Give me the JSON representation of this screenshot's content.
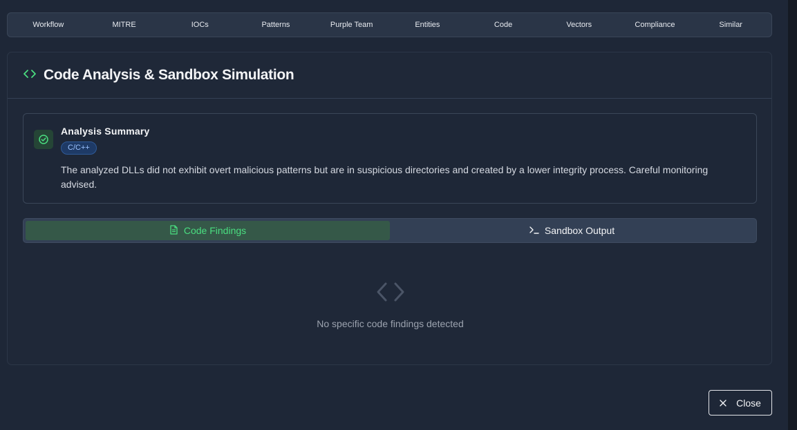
{
  "tabs": [
    "Workflow",
    "MITRE",
    "IOCs",
    "Patterns",
    "Purple Team",
    "Entities",
    "Code",
    "Vectors",
    "Compliance",
    "Similar"
  ],
  "section": {
    "icon": "code-brackets-icon",
    "title": "Code Analysis & Sandbox Simulation"
  },
  "summary": {
    "icon": "check-circle-icon",
    "title": "Analysis Summary",
    "language": "C/C++",
    "text": "The analyzed DLLs did not exhibit overt malicious patterns but are in suspicious directories and created by a lower integrity process. Careful monitoring advised."
  },
  "view_toggle": {
    "findings_label": "Code Findings",
    "findings_icon": "file-text-icon",
    "sandbox_label": "Sandbox Output",
    "sandbox_icon": "terminal-icon",
    "active": "findings"
  },
  "empty_state": {
    "icon": "code-brackets-icon",
    "message": "No specific code findings detected"
  },
  "close_label": "Close",
  "colors": {
    "accent_green": "#4ade80",
    "badge_blue": "#9cc3ff",
    "background": "#1e2737"
  }
}
